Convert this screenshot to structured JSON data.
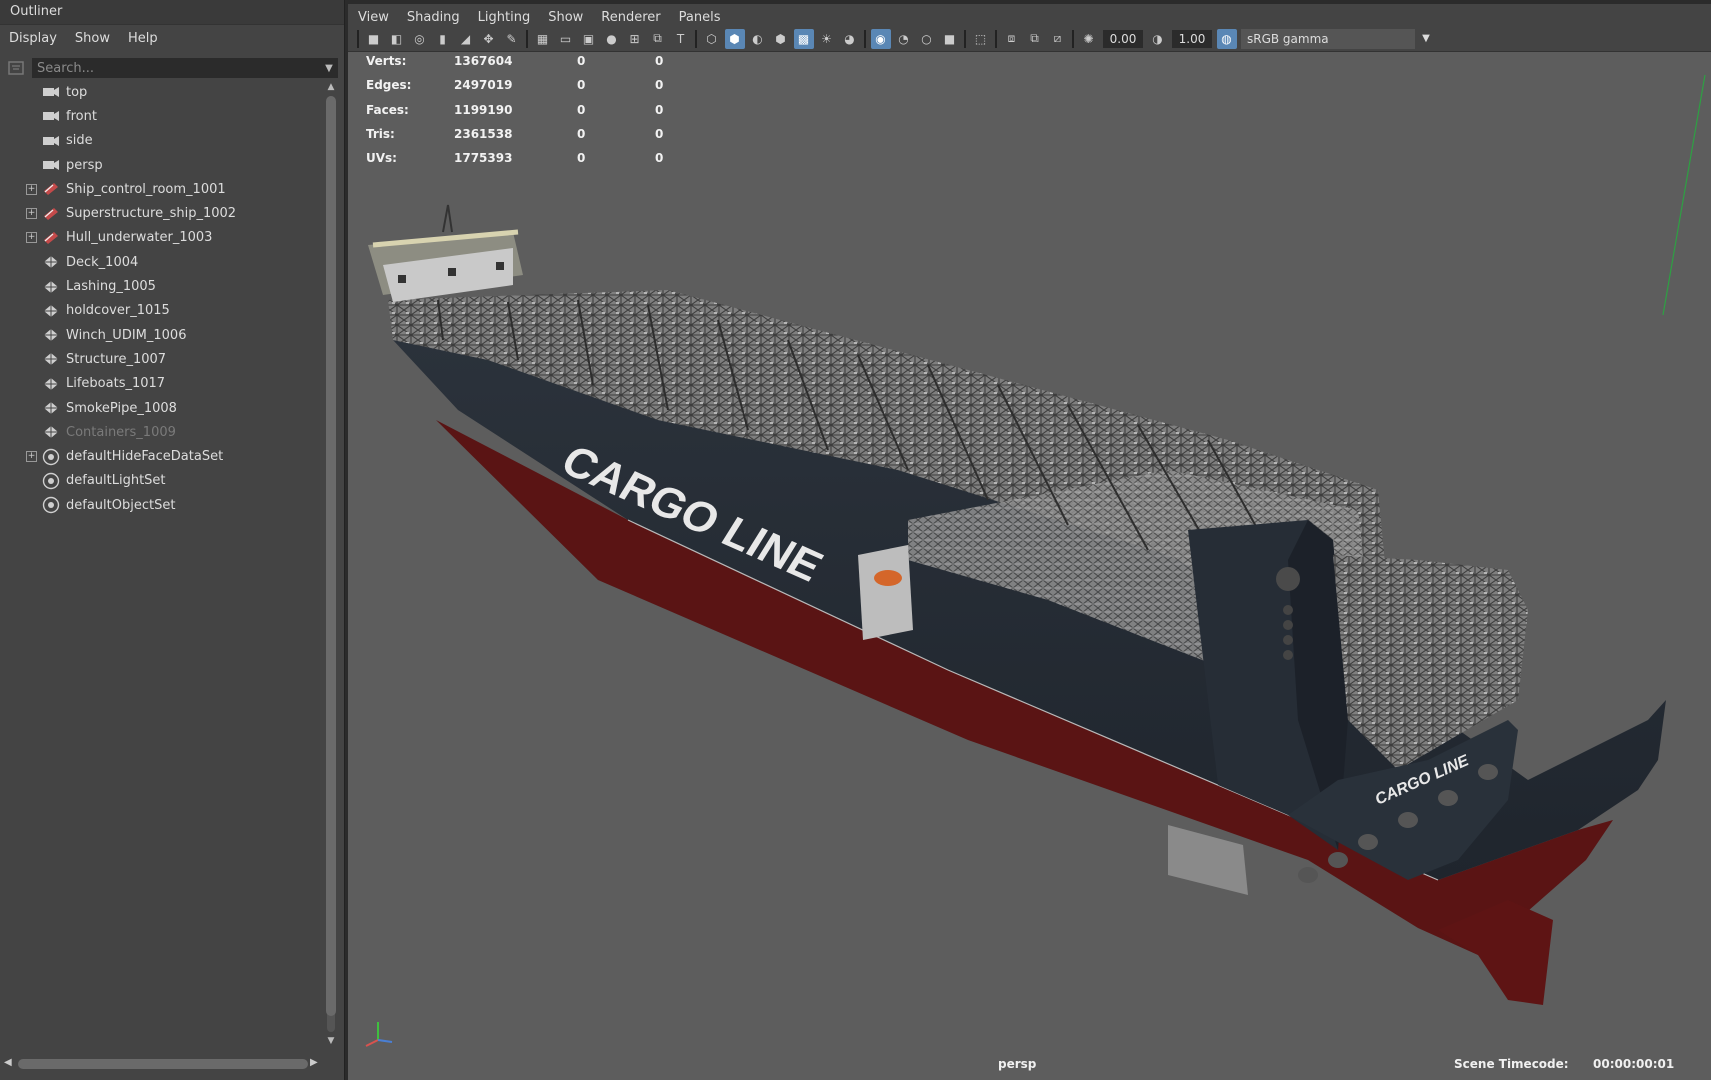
{
  "outliner": {
    "title": "Outliner",
    "menu": [
      "Display",
      "Show",
      "Help"
    ],
    "search_placeholder": "Search...",
    "items": [
      {
        "label": "top",
        "icon": "camera-icon",
        "expand": false,
        "dim": false
      },
      {
        "label": "front",
        "icon": "camera-icon",
        "expand": false,
        "dim": false
      },
      {
        "label": "side",
        "icon": "camera-icon",
        "expand": false,
        "dim": false
      },
      {
        "label": "persp",
        "icon": "camera-icon",
        "expand": false,
        "dim": false
      },
      {
        "label": "Ship_control_room_1001",
        "icon": "group-icon",
        "expand": true,
        "dim": false
      },
      {
        "label": "Superstructure_ship_1002",
        "icon": "group-icon",
        "expand": true,
        "dim": false
      },
      {
        "label": "Hull_underwater_1003",
        "icon": "group-icon",
        "expand": true,
        "dim": false
      },
      {
        "label": "Deck_1004",
        "icon": "mesh-icon",
        "expand": false,
        "dim": false
      },
      {
        "label": "Lashing_1005",
        "icon": "mesh-icon",
        "expand": false,
        "dim": false
      },
      {
        "label": "holdcover_1015",
        "icon": "mesh-icon",
        "expand": false,
        "dim": false
      },
      {
        "label": "Winch_UDIM_1006",
        "icon": "mesh-icon",
        "expand": false,
        "dim": false
      },
      {
        "label": "Structure_1007",
        "icon": "mesh-icon",
        "expand": false,
        "dim": false
      },
      {
        "label": "Lifeboats_1017",
        "icon": "mesh-icon",
        "expand": false,
        "dim": false
      },
      {
        "label": "SmokePipe_1008",
        "icon": "mesh-icon",
        "expand": false,
        "dim": false
      },
      {
        "label": "Containers_1009",
        "icon": "mesh-icon",
        "expand": false,
        "dim": true
      },
      {
        "label": "defaultHideFaceDataSet",
        "icon": "set-icon",
        "expand": true,
        "dim": false
      },
      {
        "label": "defaultLightSet",
        "icon": "set-icon",
        "expand": false,
        "dim": false
      },
      {
        "label": "defaultObjectSet",
        "icon": "set-icon",
        "expand": false,
        "dim": false
      }
    ]
  },
  "viewport": {
    "menu": [
      "View",
      "Shading",
      "Lighting",
      "Show",
      "Renderer",
      "Panels"
    ],
    "toolbar": {
      "exposure": "0.00",
      "gamma": "1.00",
      "color_management": "sRGB gamma"
    },
    "hud": [
      {
        "name": "Verts:",
        "total": "1367604",
        "selected": "0",
        "component": "0"
      },
      {
        "name": "Edges:",
        "total": "2497019",
        "selected": "0",
        "component": "0"
      },
      {
        "name": "Faces:",
        "total": "1199190",
        "selected": "0",
        "component": "0"
      },
      {
        "name": "Tris:",
        "total": "2361538",
        "selected": "0",
        "component": "0"
      },
      {
        "name": "UVs:",
        "total": "1775393",
        "selected": "0",
        "component": "0"
      }
    ],
    "camera_name": "persp",
    "timecode_label": "Scene Timecode:",
    "timecode_value": "00:00:00:01",
    "hull_text": "CARGO LINE",
    "stern_text": "CARGO LINE",
    "colors": {
      "hull": "#262d36",
      "hull_bottom": "#5b1414",
      "background": "#5d5d5d",
      "accent": "#5a87b5"
    }
  }
}
